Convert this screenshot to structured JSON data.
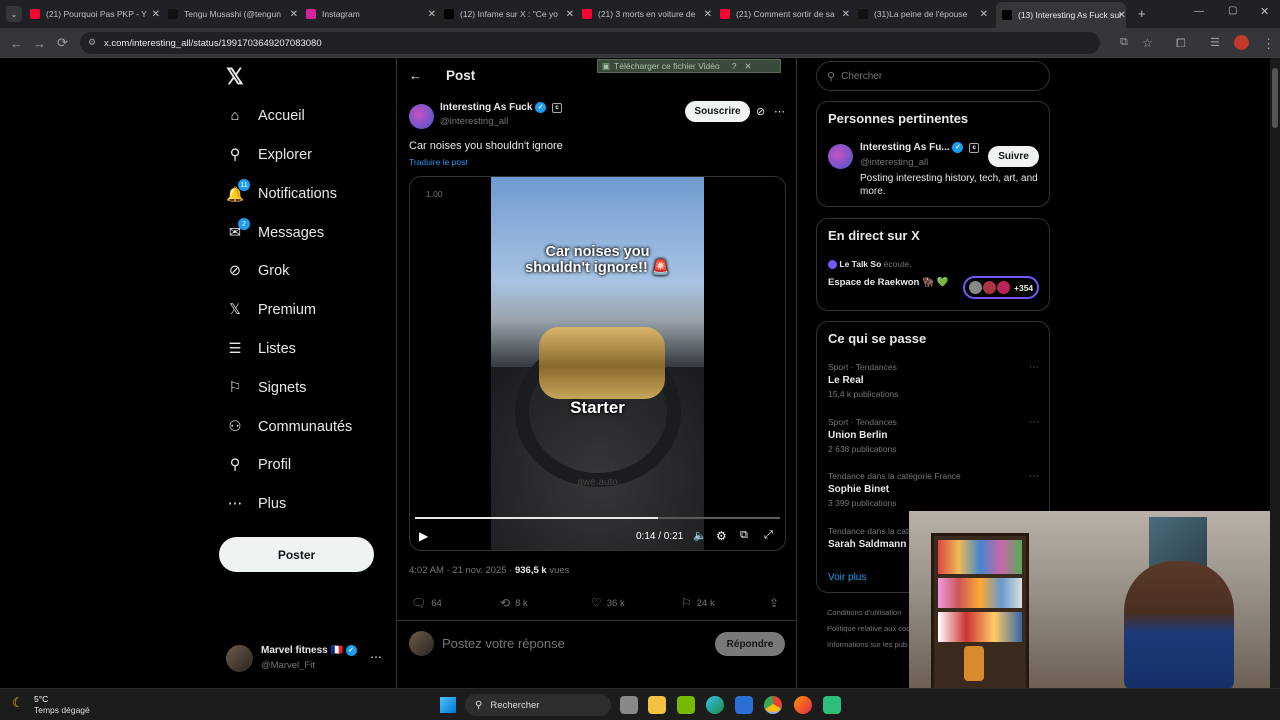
{
  "browser": {
    "tabs": [
      {
        "title": "(21) Pourquoi Pas PKP - Y",
        "color": "#ff0033"
      },
      {
        "title": "Tengu Musashi (@tengun",
        "color": "#111111"
      },
      {
        "title": "Instagram",
        "color": "#d6249f"
      },
      {
        "title": "(12) Infame sur X : \"Ce yo",
        "color": "#000000"
      },
      {
        "title": "(21) 3 morts en voiture de",
        "color": "#ff0033"
      },
      {
        "title": "(21) Comment sortir de sa",
        "color": "#ff0033"
      },
      {
        "title": "(31)La peine de l'épouse",
        "color": "#111111"
      },
      {
        "title": "(13) Interesting As Fuck sur",
        "color": "#000000"
      }
    ],
    "url": "x.com/interesting_all/status/1991703649207083080",
    "download_banner": "Télécharger ce fichier Vidéo",
    "download_banner_extra": "?"
  },
  "sidebar": {
    "logo": "𝕏",
    "items": [
      {
        "label": "Accueil",
        "icon": "home-icon",
        "glyph": "⌂"
      },
      {
        "label": "Explorer",
        "icon": "search-icon",
        "glyph": "⚲"
      },
      {
        "label": "Notifications",
        "icon": "bell-icon",
        "glyph": "🔔",
        "badge": "11"
      },
      {
        "label": "Messages",
        "icon": "mail-icon",
        "glyph": "✉",
        "badge": "2"
      },
      {
        "label": "Grok",
        "icon": "grok-icon",
        "glyph": "⊘"
      },
      {
        "label": "Premium",
        "icon": "x-premium-icon",
        "glyph": "𝕏"
      },
      {
        "label": "Listes",
        "icon": "list-icon",
        "glyph": "☰"
      },
      {
        "label": "Signets",
        "icon": "bookmark-icon",
        "glyph": "⚐"
      },
      {
        "label": "Communautés",
        "icon": "communities-icon",
        "glyph": "⚇"
      },
      {
        "label": "Profil",
        "icon": "profile-icon",
        "glyph": "⚲"
      },
      {
        "label": "Plus",
        "icon": "more-circle-icon",
        "glyph": "⋯"
      }
    ],
    "post_button": "Poster",
    "account": {
      "name": "Marvel fitness",
      "flag": "🇫🇷",
      "handle": "@Marvel_Fit"
    }
  },
  "post": {
    "header_title": "Post",
    "author_name": "Interesting As Fuck",
    "author_handle": "@interesting_all",
    "subscribe_label": "Souscrire",
    "text": "Car noises you shouldn't ignore",
    "translate_label": "Traduire le post",
    "video": {
      "speed": "1.00",
      "caption_line1": "Car noises you",
      "caption_line2": "shouldn't ignore!! 🚨",
      "part_label": "Starter",
      "watermark": "awe.auto",
      "time": "0:14 / 0:21",
      "progress": 0.667
    },
    "timestamp": "4:02 AM · 21 nov. 2025 · ",
    "views_count": "936,5 k",
    "views_label": "vues",
    "actions": {
      "replies": "64",
      "reposts": "8 k",
      "likes": "36 k",
      "bookmarks": "24 k"
    },
    "reply_placeholder": "Postez votre réponse",
    "reply_button": "Répondre"
  },
  "right": {
    "search_placeholder": "Chercher",
    "relevant": {
      "title": "Personnes pertinentes",
      "name": "Interesting As Fu...",
      "handle": "@interesting_all",
      "follow_label": "Suivre",
      "bio": "Posting interesting history, tech, art, and more."
    },
    "live": {
      "title": "En direct sur X",
      "host": "Le Talk So",
      "host_status": "écoute.",
      "space": "Espace de Raekwon 🦬 💚",
      "listeners": "+354"
    },
    "trends": {
      "title": "Ce qui se passe",
      "items": [
        {
          "category": "Sport · Tendances",
          "name": "Le Real",
          "count": "15,4 k publications"
        },
        {
          "category": "Sport · Tendances",
          "name": "Union Berlin",
          "count": "2 638 publications"
        },
        {
          "category": "Tendance dans la catégorie France",
          "name": "Sophie Binet",
          "count": "3 399 publications"
        },
        {
          "category": "Tendance dans la catégorie France",
          "name": "Sarah Saldmann",
          "count": ""
        }
      ],
      "see_more": "Voir plus"
    },
    "footer": [
      "Conditions d'utilisation",
      "Politique relative aux coo",
      "Informations sur les pub"
    ]
  },
  "taskbar": {
    "weather_temp": "5°C",
    "weather_desc": "Temps dégagé",
    "search": "Rechercher"
  }
}
